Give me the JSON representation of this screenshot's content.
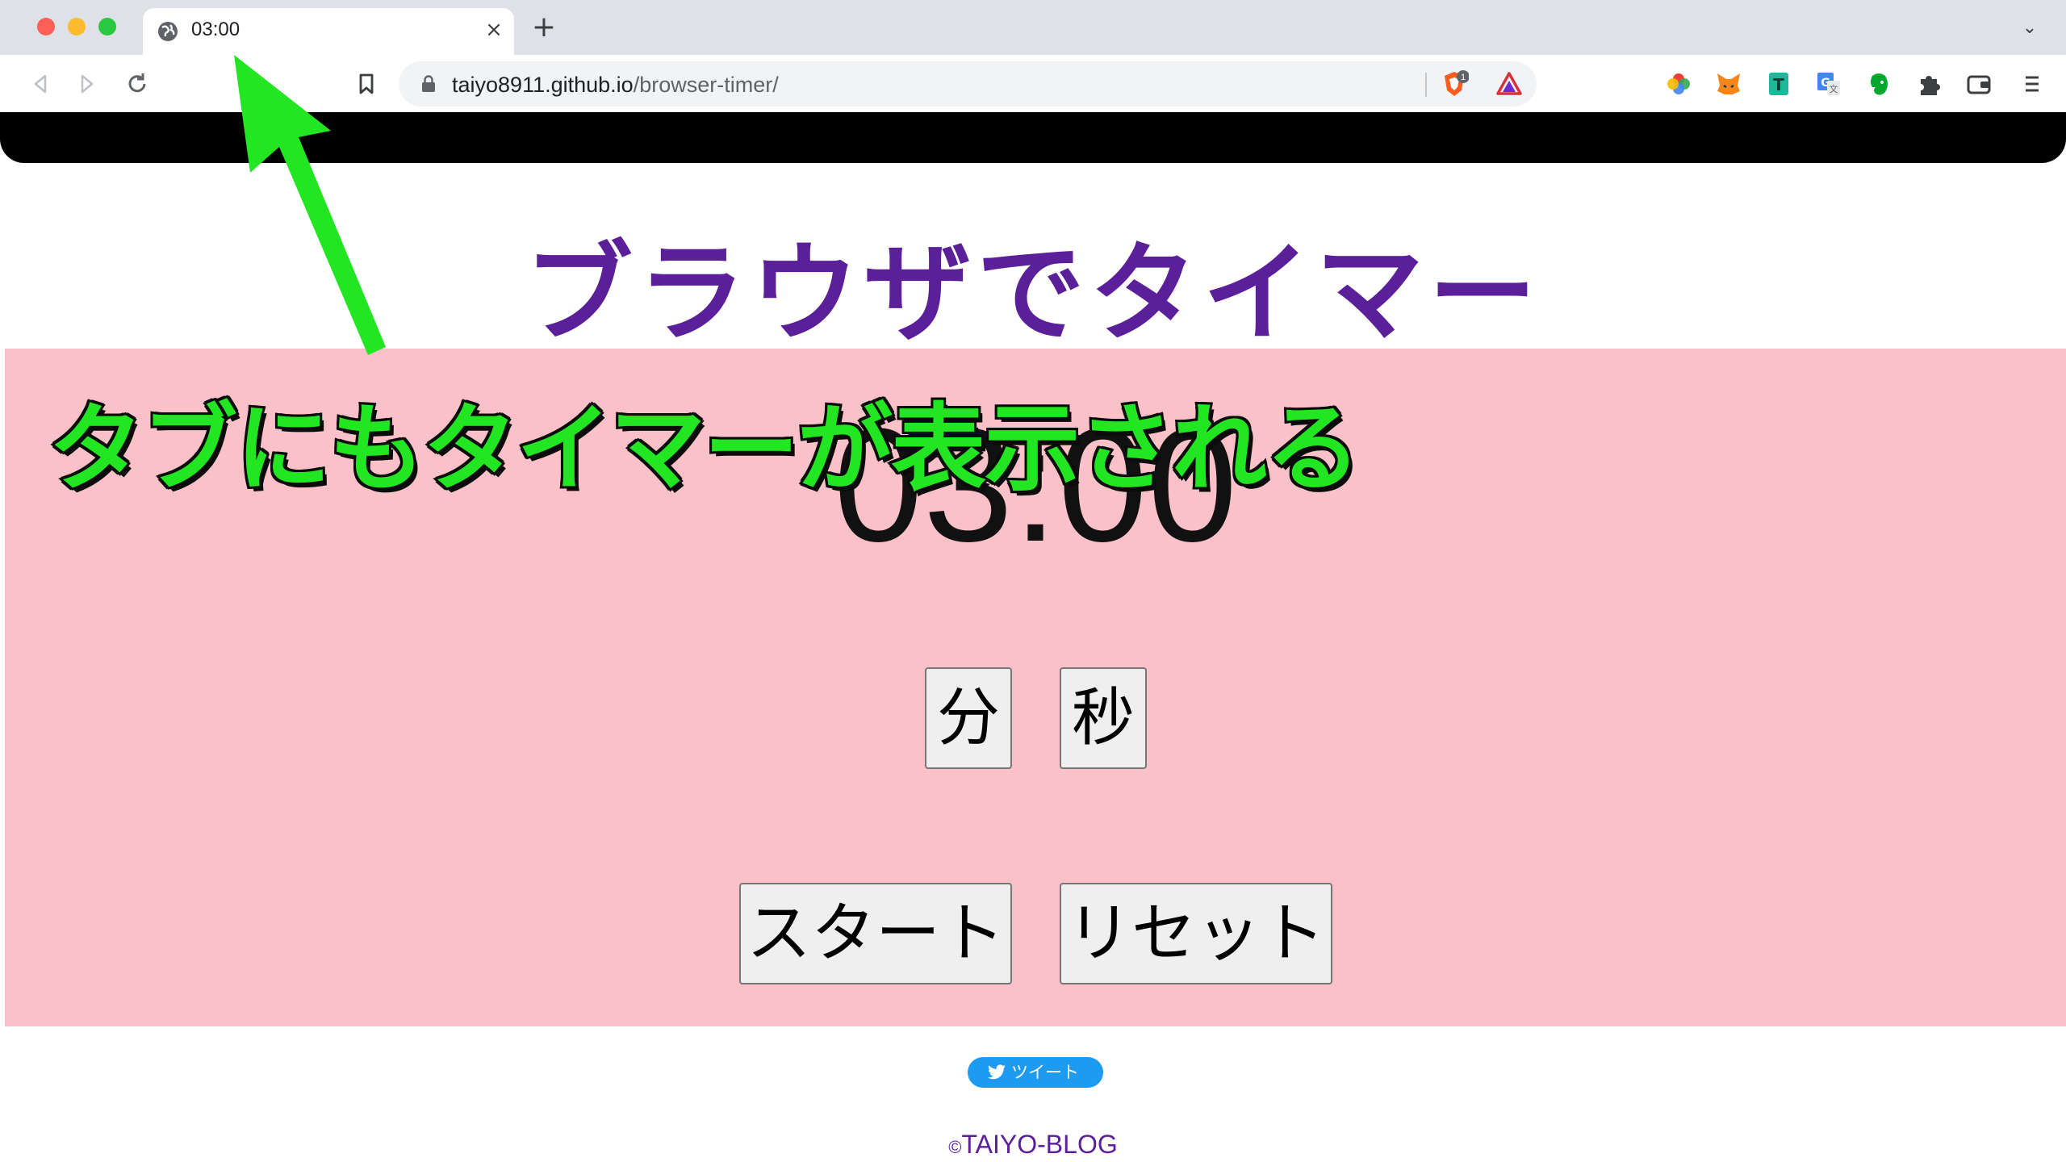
{
  "browser": {
    "tab_title": "03:00",
    "tab_close": "×",
    "new_tab": "+",
    "tab_search": "⌄",
    "url_host": "taiyo8911.github.io",
    "url_path": "/browser-timer/",
    "brave_badge": "1"
  },
  "page": {
    "title": "ブラウザでタイマー",
    "timer": "03:00",
    "buttons": {
      "minute": "分",
      "second": "秒",
      "start": "スタート",
      "reset": "リセット"
    },
    "tweet": "ツイート",
    "footer_symbol": "©",
    "footer_text": "TAIYO-BLOG"
  },
  "annotation": {
    "text": "タブにもタイマーが表示される",
    "color": "#22e622"
  },
  "colors": {
    "title": "#5a1f99",
    "panel": "#fbc1c9",
    "tweet": "#1d9bf0"
  }
}
